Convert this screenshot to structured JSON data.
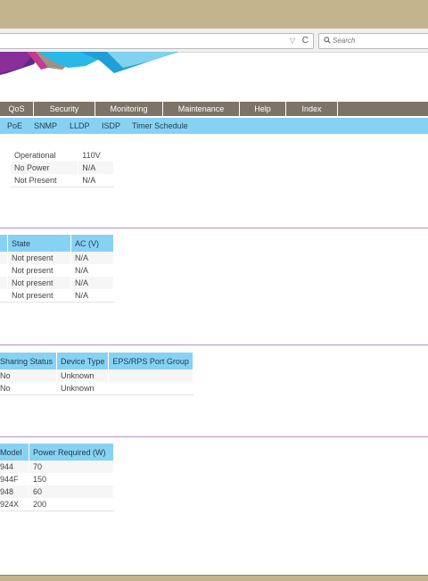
{
  "browser": {
    "search_placeholder": "Search",
    "dropdown_glyph": "▽",
    "reload_glyph": "C"
  },
  "menu": [
    "QoS",
    "Security",
    "Monitoring",
    "Maintenance",
    "Help",
    "Index"
  ],
  "submenu": [
    "PoE",
    "SNMP",
    "LLDP",
    "ISDP",
    "Timer Schedule"
  ],
  "power_status": {
    "rows": [
      [
        "Operational",
        "110V"
      ],
      [
        "No Power",
        "N/A"
      ],
      [
        "Not Present",
        "N/A"
      ]
    ]
  },
  "rps_modules": {
    "headers": [
      "State",
      "AC (V)"
    ],
    "rows": [
      [
        "Not present",
        "N/A"
      ],
      [
        "Not present",
        "N/A"
      ],
      [
        "Not present",
        "N/A"
      ],
      [
        "Not present",
        "N/A"
      ]
    ]
  },
  "eps_groups": {
    "headers": [
      "Sharing Status",
      "Device Type",
      "EPS/RPS Port Group"
    ],
    "rows": [
      [
        "No",
        "Unknown",
        ""
      ],
      [
        "No",
        "Unknown",
        ""
      ]
    ]
  },
  "power_required": {
    "headers": [
      "Model",
      "Power Required (W)"
    ],
    "rows": [
      [
        "944",
        "70"
      ],
      [
        "944F",
        "150"
      ],
      [
        "948",
        "60"
      ],
      [
        "924X",
        "200"
      ]
    ]
  },
  "colors": {
    "window_frame": "#c4b48e",
    "menu_bg": "#7d7366",
    "submenu_bg": "#87d2f3",
    "table_header": "#87d2f3",
    "divider": "#b591c6"
  }
}
